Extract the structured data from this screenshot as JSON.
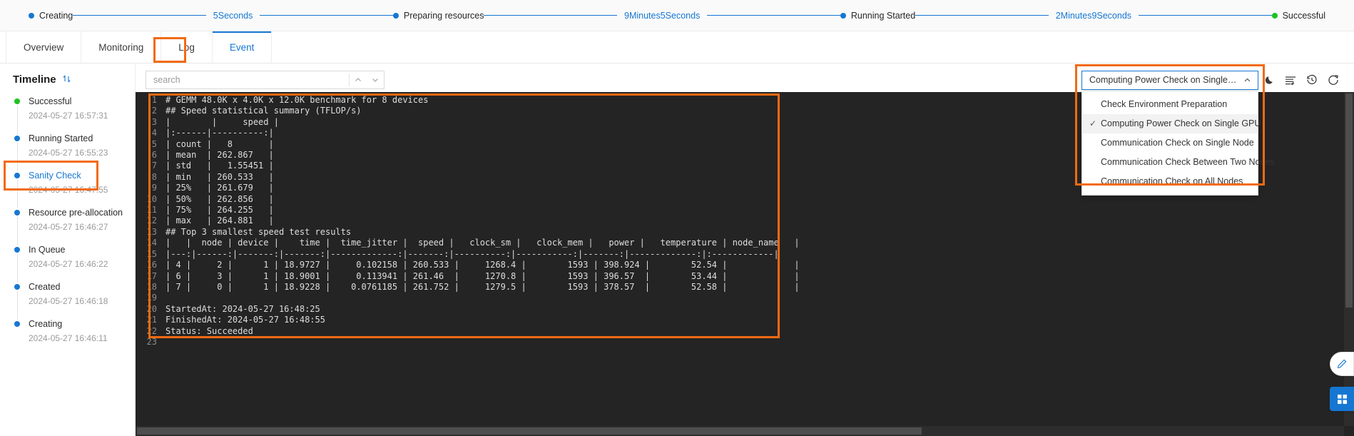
{
  "status_timeline": {
    "nodes": [
      {
        "label": "Creating",
        "color": "#1677d2"
      },
      {
        "label": "Preparing resources",
        "color": "#1677d2"
      },
      {
        "label": "Running Started",
        "color": "#1677d2"
      },
      {
        "label": "Successful",
        "color": "#1ec31e"
      }
    ],
    "durations": [
      "5Seconds",
      "9Minutes5Seconds",
      "2Minutes9Seconds"
    ]
  },
  "tabs": [
    {
      "label": "Overview",
      "active": false
    },
    {
      "label": "Monitoring",
      "active": false
    },
    {
      "label": "Log",
      "active": false
    },
    {
      "label": "Event",
      "active": true
    }
  ],
  "sidebar": {
    "title": "Timeline",
    "sort_icon": "sort-arrows-icon",
    "items": [
      {
        "name": "Successful",
        "time": "2024-05-27 16:57:31",
        "dot": "green",
        "selected": false
      },
      {
        "name": "Running Started",
        "time": "2024-05-27 16:55:23",
        "dot": "blue",
        "selected": false
      },
      {
        "name": "Sanity Check",
        "time": "2024-05-27 16:47:55",
        "dot": "blue",
        "selected": true
      },
      {
        "name": "Resource pre-allocation",
        "time": "2024-05-27 16:46:27",
        "dot": "blue",
        "selected": false
      },
      {
        "name": "In Queue",
        "time": "2024-05-27 16:46:22",
        "dot": "blue",
        "selected": false
      },
      {
        "name": "Created",
        "time": "2024-05-27 16:46:18",
        "dot": "blue",
        "selected": false
      },
      {
        "name": "Creating",
        "time": "2024-05-27 16:46:11",
        "dot": "blue",
        "selected": false
      }
    ]
  },
  "toolbar": {
    "search_placeholder": "search",
    "search_value": "",
    "prev_icon": "chevron-up-icon",
    "next_icon": "chevron-down-icon",
    "icons": [
      {
        "name": "moon-icon",
        "title": "dark-mode"
      },
      {
        "name": "wrap-text-icon",
        "title": "wrap-lines"
      },
      {
        "name": "history-icon",
        "title": "history"
      },
      {
        "name": "refresh-icon",
        "title": "refresh"
      }
    ]
  },
  "check_select": {
    "selected": "Computing Power Check on Single GPU",
    "caret_icon": "chevron-up-icon",
    "check_glyph": "✓",
    "options": [
      {
        "label": "Check Environment Preparation",
        "checked": false
      },
      {
        "label": "Computing Power Check on Single GPU",
        "checked": true
      },
      {
        "label": "Communication Check on Single Node",
        "checked": false
      },
      {
        "label": "Communication Check Between Two Nodes",
        "checked": false
      },
      {
        "label": "Communication Check on All Nodes",
        "checked": false
      }
    ]
  },
  "terminal": {
    "lines": [
      {
        "n": "1",
        "text": "# GEMM 48.0K x 4.0K x 12.0K benchmark for 8 devices"
      },
      {
        "n": "2",
        "text": "## Speed statistical summary (TFLOP/s)"
      },
      {
        "n": "3",
        "text": "|        |     speed |"
      },
      {
        "n": "4",
        "text": "|:------|----------:|"
      },
      {
        "n": "5",
        "text": "| count |   8       |"
      },
      {
        "n": "6",
        "text": "| mean  | 262.867   |"
      },
      {
        "n": "7",
        "text": "| std   |   1.55451 |"
      },
      {
        "n": "8",
        "text": "| min   | 260.533   |"
      },
      {
        "n": "9",
        "text": "| 25%   | 261.679   |"
      },
      {
        "n": "10",
        "text": "| 50%   | 262.856   |"
      },
      {
        "n": "11",
        "text": "| 75%   | 264.255   |"
      },
      {
        "n": "12",
        "text": "| max   | 264.881   |"
      },
      {
        "n": "13",
        "text": "## Top 3 smallest speed test results"
      },
      {
        "n": "14",
        "text": "|   |  node | device |    time |  time_jitter |  speed |   clock_sm |   clock_mem |   power |   temperature | node_name   |"
      },
      {
        "n": "15",
        "text": "|---:|------:|-------:|-------:|-------------:|-------:|----------:|-----------:|-------:|-------------:|:------------|"
      },
      {
        "n": "16",
        "text": "| 4 |     2 |      1 | 18.9727 |     0.102158 | 260.533 |     1268.4 |        1593 | 398.924 |        52.54 |             |"
      },
      {
        "n": "17",
        "text": "| 6 |     3 |      1 | 18.9001 |     0.113941 | 261.46  |     1270.8 |        1593 | 396.57  |        53.44 |             |"
      },
      {
        "n": "18",
        "text": "| 7 |     0 |      1 | 18.9228 |    0.0761185 | 261.752 |     1279.5 |        1593 | 378.57  |        52.58 |             |"
      },
      {
        "n": "19",
        "text": ""
      },
      {
        "n": "20",
        "text": "StartedAt: 2024-05-27 16:48:25"
      },
      {
        "n": "21",
        "text": "FinishedAt: 2024-05-27 16:48:55"
      },
      {
        "n": "22",
        "text": "Status: Succeeded"
      },
      {
        "n": "23",
        "text": ""
      }
    ]
  },
  "floating_buttons": [
    {
      "name": "edit-pencil-icon"
    },
    {
      "name": "grid-apps-icon"
    }
  ],
  "colors": {
    "accent_blue": "#1677d2",
    "success_green": "#1ec31e",
    "highlight_orange": "#f26a12",
    "terminal_bg": "#242424"
  }
}
